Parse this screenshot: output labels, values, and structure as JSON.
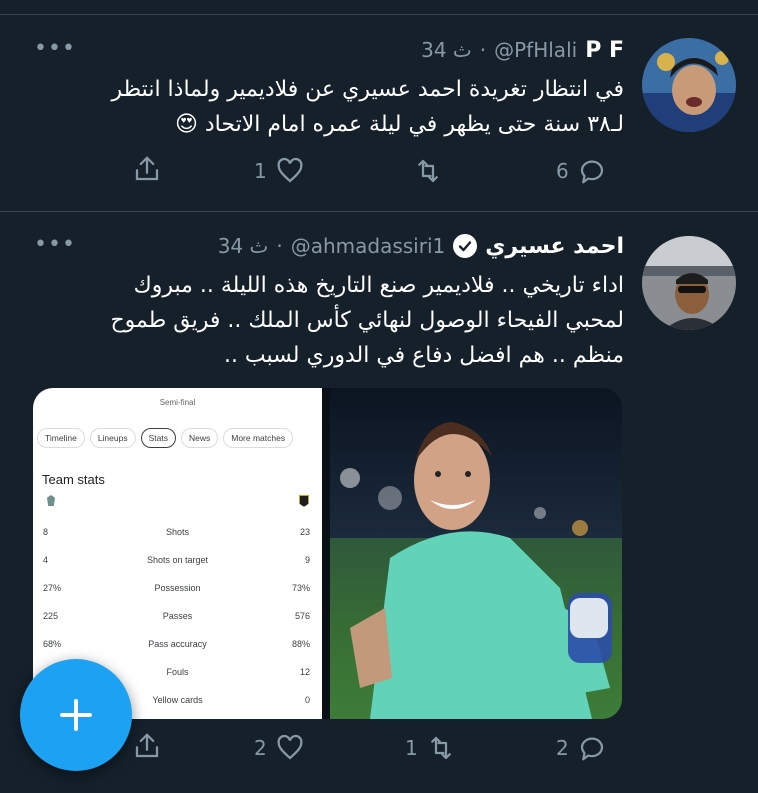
{
  "tweets": [
    {
      "display_name": "P F",
      "handle": "@PfHlali",
      "time": "34 ث",
      "text_line1": "في انتظار تغريدة احمد عسيري عن فلاديمير ولماذا انتظر",
      "text_line2": "لـ٣٨ سنة حتى يظهر في ليلة عمره امام الاتحاد 😍",
      "reply_count": "6",
      "retweet_count": "",
      "like_count": "1"
    },
    {
      "display_name": "احمد عسيري",
      "handle": "@ahmadassiri1",
      "time": "34 ث",
      "text_line1": "اداء تاريخي .. فلاديمير صنع التاريخ هذه الليلة .. مبروك",
      "text_line2": "لمحبي الفيحاء الوصول لنهائي كأس الملك .. فريق طموح",
      "text_line3": "منظم .. هم افضل دفاع في الدوري لسبب ..",
      "reply_count": "2",
      "retweet_count": "1",
      "like_count": "2"
    }
  ],
  "stats_image": {
    "top_title": "Semi-final",
    "tabs": [
      "Timeline",
      "Lineups",
      "Stats",
      "News",
      "More matches"
    ],
    "active_tab": "Stats",
    "section_title": "Team stats",
    "rows": [
      {
        "left": "8",
        "label": "Shots",
        "right": "23"
      },
      {
        "left": "4",
        "label": "Shots on target",
        "right": "9"
      },
      {
        "left": "27%",
        "label": "Possession",
        "right": "73%"
      },
      {
        "left": "225",
        "label": "Passes",
        "right": "576"
      },
      {
        "left": "68%",
        "label": "Pass accuracy",
        "right": "88%"
      },
      {
        "left": "",
        "label": "Fouls",
        "right": "12"
      },
      {
        "left": "",
        "label": "Yellow cards",
        "right": "0"
      }
    ]
  },
  "colors": {
    "background": "#15202b",
    "secondary_text": "#8899a6",
    "accent": "#1da1f2",
    "divider": "#38444d"
  },
  "icons": [
    "more-icon",
    "reply-icon",
    "retweet-icon",
    "like-icon",
    "share-icon",
    "verified-icon",
    "compose-icon"
  ]
}
